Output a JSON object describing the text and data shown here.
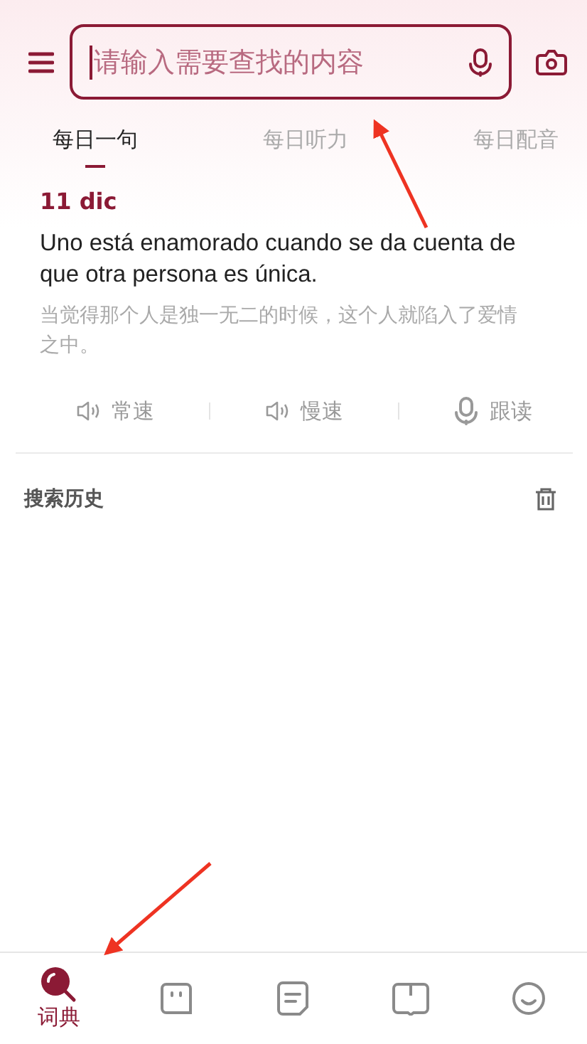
{
  "search": {
    "placeholder": "请输入需要查找的内容"
  },
  "tabs": [
    {
      "label": "每日一句",
      "selected": true
    },
    {
      "label": "每日听力",
      "selected": false
    },
    {
      "label": "每日配音",
      "selected": false
    }
  ],
  "daily": {
    "date": "11 dic",
    "sentence": "Uno está enamorado cuando se da cuenta de que otra persona es única.",
    "translation": "当觉得那个人是独一无二的时候，这个人就陷入了爱情之中。",
    "actions": [
      {
        "kind": "speaker",
        "label": "常速"
      },
      {
        "kind": "speaker",
        "label": "慢速"
      },
      {
        "kind": "mic",
        "label": "跟读"
      }
    ]
  },
  "history": {
    "title": "搜索历史"
  },
  "nav": [
    {
      "kind": "dictionary",
      "label": "词典",
      "selected": true
    },
    {
      "kind": "chat",
      "selected": false
    },
    {
      "kind": "note",
      "selected": false
    },
    {
      "kind": "book",
      "selected": false
    },
    {
      "kind": "smile",
      "selected": false
    }
  ]
}
